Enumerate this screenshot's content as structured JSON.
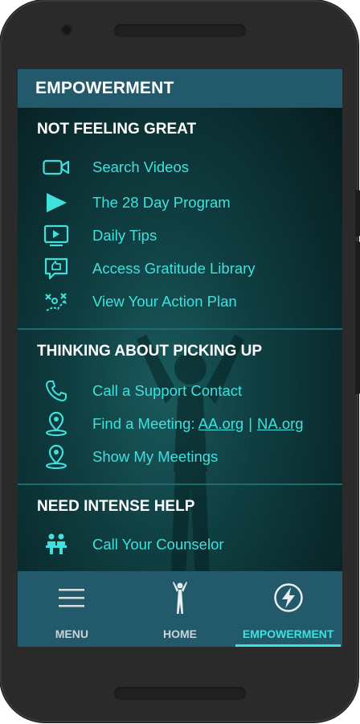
{
  "app": {
    "title": "EMPOWERMENT"
  },
  "sections": [
    {
      "title": "NOT FEELING GREAT",
      "items": [
        {
          "label": "Search Videos",
          "icon": "video-camera-icon"
        },
        {
          "label": "The 28 Day Program",
          "icon": "play-icon"
        },
        {
          "label": "Daily Tips",
          "icon": "tips-screen-icon"
        },
        {
          "label": "Access Gratitude Library",
          "icon": "gratitude-icon"
        },
        {
          "label": "View Your Action Plan",
          "icon": "action-plan-icon"
        }
      ]
    },
    {
      "title": "THINKING ABOUT PICKING UP",
      "items": [
        {
          "label": "Call a Support Contact",
          "icon": "phone-icon"
        },
        {
          "label": "Find a Meeting: ",
          "link1": "AA.org",
          "separator": "|",
          "link2": "NA.org",
          "icon": "location-pin-icon"
        },
        {
          "label": "Show My Meetings",
          "icon": "location-pin-icon"
        }
      ]
    },
    {
      "title": "NEED INTENSE HELP",
      "items": [
        {
          "label": "Call Your Counselor",
          "icon": "counselor-icon"
        }
      ]
    }
  ],
  "tabs": [
    {
      "label": "MENU",
      "icon": "hamburger-menu-icon",
      "active": false
    },
    {
      "label": "HOME",
      "icon": "person-arms-up-icon",
      "active": false
    },
    {
      "label": "EMPOWERMENT",
      "icon": "lightning-bolt-icon",
      "active": true
    }
  ],
  "colors": {
    "accent": "#41e0dc",
    "bar": "#235a6b",
    "background": "#0f3e41"
  }
}
